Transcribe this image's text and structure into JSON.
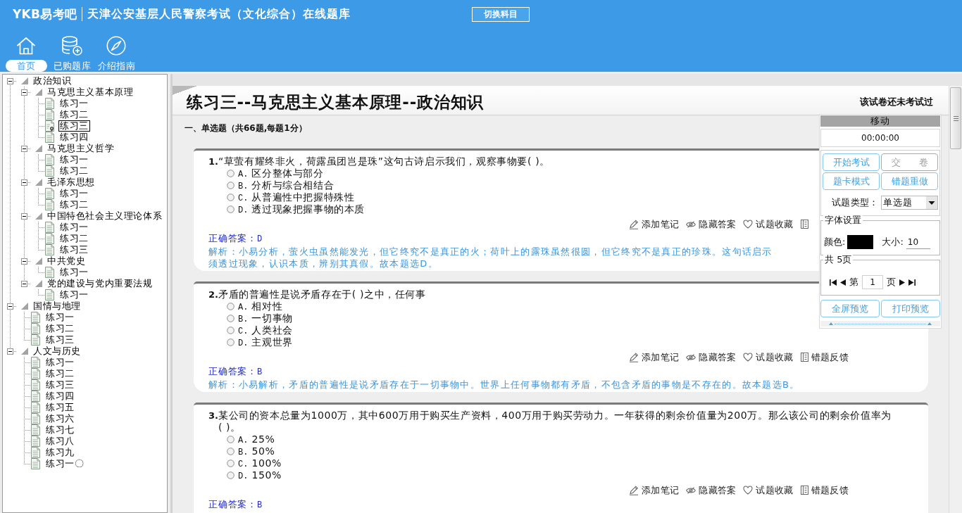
{
  "header": {
    "logo": "YKB易考吧",
    "title": "天津公安基层人民警察考试（文化综合）在线题库",
    "switch_button": "切换科目"
  },
  "nav": [
    {
      "kind": "home",
      "label": "首页",
      "selected": true
    },
    {
      "kind": "library",
      "label": "已购题库",
      "selected": false
    },
    {
      "kind": "guide",
      "label": "介绍指南",
      "selected": false
    }
  ],
  "tree": [
    {
      "label": "政治知识",
      "expanded": true,
      "selected": false,
      "children": [
        {
          "label": "马克思主义基本原理",
          "expanded": true,
          "selected": false,
          "children": [
            {
              "label": "练习一",
              "selected": false
            },
            {
              "label": "练习二",
              "selected": false
            },
            {
              "label": "练习三",
              "selected": true
            },
            {
              "label": "练习四",
              "selected": false
            }
          ]
        },
        {
          "label": "马克思主义哲学",
          "expanded": true,
          "selected": false,
          "children": [
            {
              "label": "练习一",
              "selected": false
            },
            {
              "label": "练习二",
              "selected": false
            }
          ]
        },
        {
          "label": "毛泽东思想",
          "expanded": true,
          "selected": false,
          "children": [
            {
              "label": "练习一",
              "selected": false
            },
            {
              "label": "练习二",
              "selected": false
            }
          ]
        },
        {
          "label": "中国特色社会主义理论体系",
          "expanded": true,
          "selected": false,
          "children": [
            {
              "label": "练习一",
              "selected": false
            },
            {
              "label": "练习二",
              "selected": false
            },
            {
              "label": "练习三",
              "selected": false
            }
          ]
        },
        {
          "label": "中共党史",
          "expanded": true,
          "selected": false,
          "children": [
            {
              "label": "练习一",
              "selected": false
            }
          ]
        },
        {
          "label": "党的建设与党内重要法规",
          "expanded": true,
          "selected": false,
          "children": [
            {
              "label": "练习一",
              "selected": false
            }
          ]
        }
      ]
    },
    {
      "label": "国情与地理",
      "expanded": true,
      "selected": false,
      "children": [
        {
          "label": "练习一",
          "selected": false
        },
        {
          "label": "练习二",
          "selected": false
        },
        {
          "label": "练习三",
          "selected": false
        }
      ]
    },
    {
      "label": "人文与历史",
      "expanded": true,
      "selected": false,
      "children": [
        {
          "label": "练习一",
          "selected": false
        },
        {
          "label": "练习二",
          "selected": false
        },
        {
          "label": "练习三",
          "selected": false
        },
        {
          "label": "练习四",
          "selected": false
        },
        {
          "label": "练习五",
          "selected": false
        },
        {
          "label": "练习六",
          "selected": false
        },
        {
          "label": "练习七",
          "selected": false
        },
        {
          "label": "练习八",
          "selected": false
        },
        {
          "label": "练习九",
          "selected": false
        },
        {
          "label": "练习一〇",
          "selected": false
        }
      ]
    }
  ],
  "paper": {
    "title": "练习三--马克思主义基本原理--政治知识",
    "status": "该试卷还未考试过",
    "section": "一、单选题（共66题,每题1分）"
  },
  "questions": [
    {
      "number": "1.",
      "text": "“草萤有耀终非火，荷露虽团岂是珠”这句古诗启示我们，观察事物要( )。",
      "options": [
        {
          "label": "A.",
          "text": "区分整体与部分",
          "selected": false
        },
        {
          "label": "B.",
          "text": "分析与综合相结合",
          "selected": false
        },
        {
          "label": "C.",
          "text": "从普遍性中把握特殊性",
          "selected": false
        },
        {
          "label": "D.",
          "text": "透过现象把握事物的本质",
          "selected": false
        }
      ],
      "actions": [
        {
          "kind": "note",
          "label": "添加笔记"
        },
        {
          "kind": "hide",
          "label": "隐藏答案"
        },
        {
          "kind": "favorite",
          "label": "试题收藏"
        },
        {
          "kind": "feedback"
        }
      ],
      "answer_label": "正确答案：",
      "answer": "D",
      "analysis": [
        "解析：小易分析，萤火虫虽然能发光，但它终究不是真正的火；荷叶上的露珠虽然很圆，但它终究不是真正的珍珠。这句话启示",
        "须透过现象，认识本质，辨别其真假。故本题选D。"
      ]
    },
    {
      "number": "2.",
      "text": "矛盾的普遍性是说矛盾存在于( )之中，任何事",
      "options": [
        {
          "label": "A.",
          "text": "相对性",
          "selected": false
        },
        {
          "label": "B.",
          "text": "一切事物",
          "selected": false
        },
        {
          "label": "C.",
          "text": "人类社会",
          "selected": false
        },
        {
          "label": "D.",
          "text": "主观世界",
          "selected": false
        }
      ],
      "actions": [
        {
          "kind": "note",
          "label": "添加笔记"
        },
        {
          "kind": "hide",
          "label": "隐藏答案"
        },
        {
          "kind": "favorite",
          "label": "试题收藏"
        },
        {
          "kind": "feedback",
          "label": "错题反馈"
        }
      ],
      "answer_label": "正确答案：",
      "answer": "B",
      "analysis": [
        "解析：小易解析，矛盾的普遍性是说矛盾存在于一切事物中。世界上任何事物都有矛盾，不包含矛盾的事物是不存在的。故本题选B。"
      ]
    },
    {
      "number": "3.",
      "text": "某公司的资本总量为1000万，其中600万用于购买生产资料，400万用于购买劳动力。一年获得的剩余价值量为200万。那么该公司的剩余价值率为( )。",
      "options": [
        {
          "label": "A.",
          "text": "25%",
          "selected": false
        },
        {
          "label": "B.",
          "text": "50%",
          "selected": false
        },
        {
          "label": "C.",
          "text": "100%",
          "selected": false
        },
        {
          "label": "D.",
          "text": "150%",
          "selected": false
        }
      ],
      "actions": [
        {
          "kind": "note",
          "label": "添加笔记"
        },
        {
          "kind": "hide",
          "label": "隐藏答案"
        },
        {
          "kind": "favorite",
          "label": "试题收藏"
        },
        {
          "kind": "feedback",
          "label": "错题反馈"
        }
      ],
      "answer_label": "正确答案：",
      "answer": "B"
    }
  ],
  "panel": {
    "handle": "移动",
    "timer": "00:00:00",
    "buttons": [
      {
        "label": "开始考试",
        "disabled": false
      },
      {
        "label": "交　　卷",
        "disabled": true
      },
      {
        "label": "题卡模式",
        "disabled": false
      },
      {
        "label": "错题重做",
        "disabled": false
      }
    ],
    "type_select": {
      "label": "试题类型：",
      "value": "单选题"
    },
    "font_settings": {
      "legend": "字体设置",
      "color_label": "颜色:",
      "color": "#000000",
      "size_label": "大小:",
      "size": "10"
    },
    "pager": {
      "legend": "共 5页",
      "prefix": "第",
      "page": "1",
      "suffix": "页"
    },
    "preview_buttons": [
      {
        "label": "全屏预览"
      },
      {
        "label": "打印预览"
      }
    ]
  }
}
